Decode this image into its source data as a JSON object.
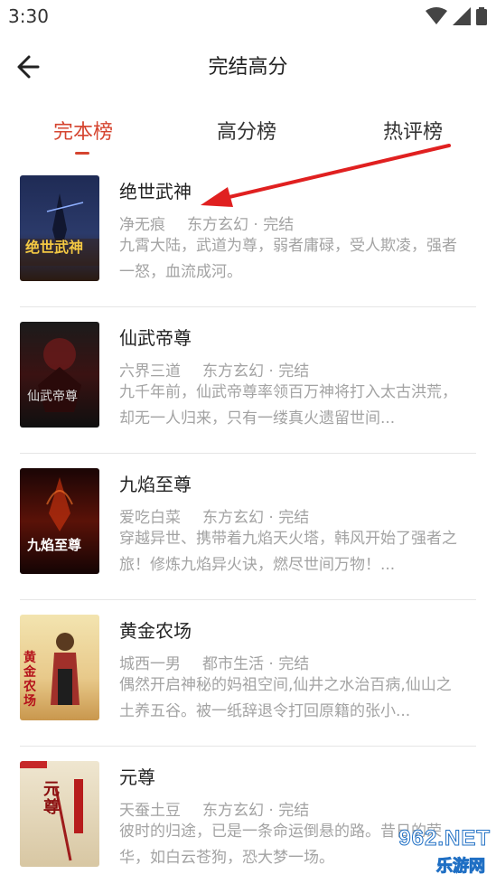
{
  "status": {
    "time": "3:30"
  },
  "header": {
    "title": "完结高分"
  },
  "tabs": [
    {
      "label": "完本榜",
      "active": true
    },
    {
      "label": "高分榜",
      "active": false
    },
    {
      "label": "热评榜",
      "active": false
    }
  ],
  "books": [
    {
      "title": "绝世武神",
      "author": "净无痕",
      "genre": "东方玄幻 · 完结",
      "desc": "九霄大陆，武道为尊，弱者庸碌，受人欺凌，强者一怒，血流成河。",
      "cover_text": "绝世武神"
    },
    {
      "title": "仙武帝尊",
      "author": "六界三道",
      "genre": "东方玄幻 · 完结",
      "desc": "九千年前，仙武帝尊率领百万神将打入太古洪荒，却无一人归来，只有一缕真火遗留世间...",
      "cover_text": "仙武帝尊"
    },
    {
      "title": "九焰至尊",
      "author": "爱吃白菜",
      "genre": "东方玄幻 · 完结",
      "desc": "穿越异世、携带着九焰天火塔，韩风开始了强者之旅！修炼九焰异火诀，燃尽世间万物！...",
      "cover_text": "九焰至尊"
    },
    {
      "title": "黄金农场",
      "author": "城西一男",
      "genre": "都市生活 · 完结",
      "desc": "偶然开启神秘的妈祖空间,仙井之水治百病,仙山之土养五谷。被一纸辞退令打回原籍的张小...",
      "cover_text": "黄金农场"
    },
    {
      "title": "元尊",
      "author": "天蚕土豆",
      "genre": "东方玄幻 · 完结",
      "desc": "彼时的归途，已是一条命运倒悬的路。昔日的荣华，如白云苍狗，恐大梦一场。",
      "cover_text": "元尊"
    }
  ],
  "watermark": {
    "top": "962.NET",
    "bottom": "乐游网"
  },
  "colors": {
    "accent": "#d5442f",
    "meta": "#a3a3a3",
    "annotation_arrow": "#e02020"
  }
}
